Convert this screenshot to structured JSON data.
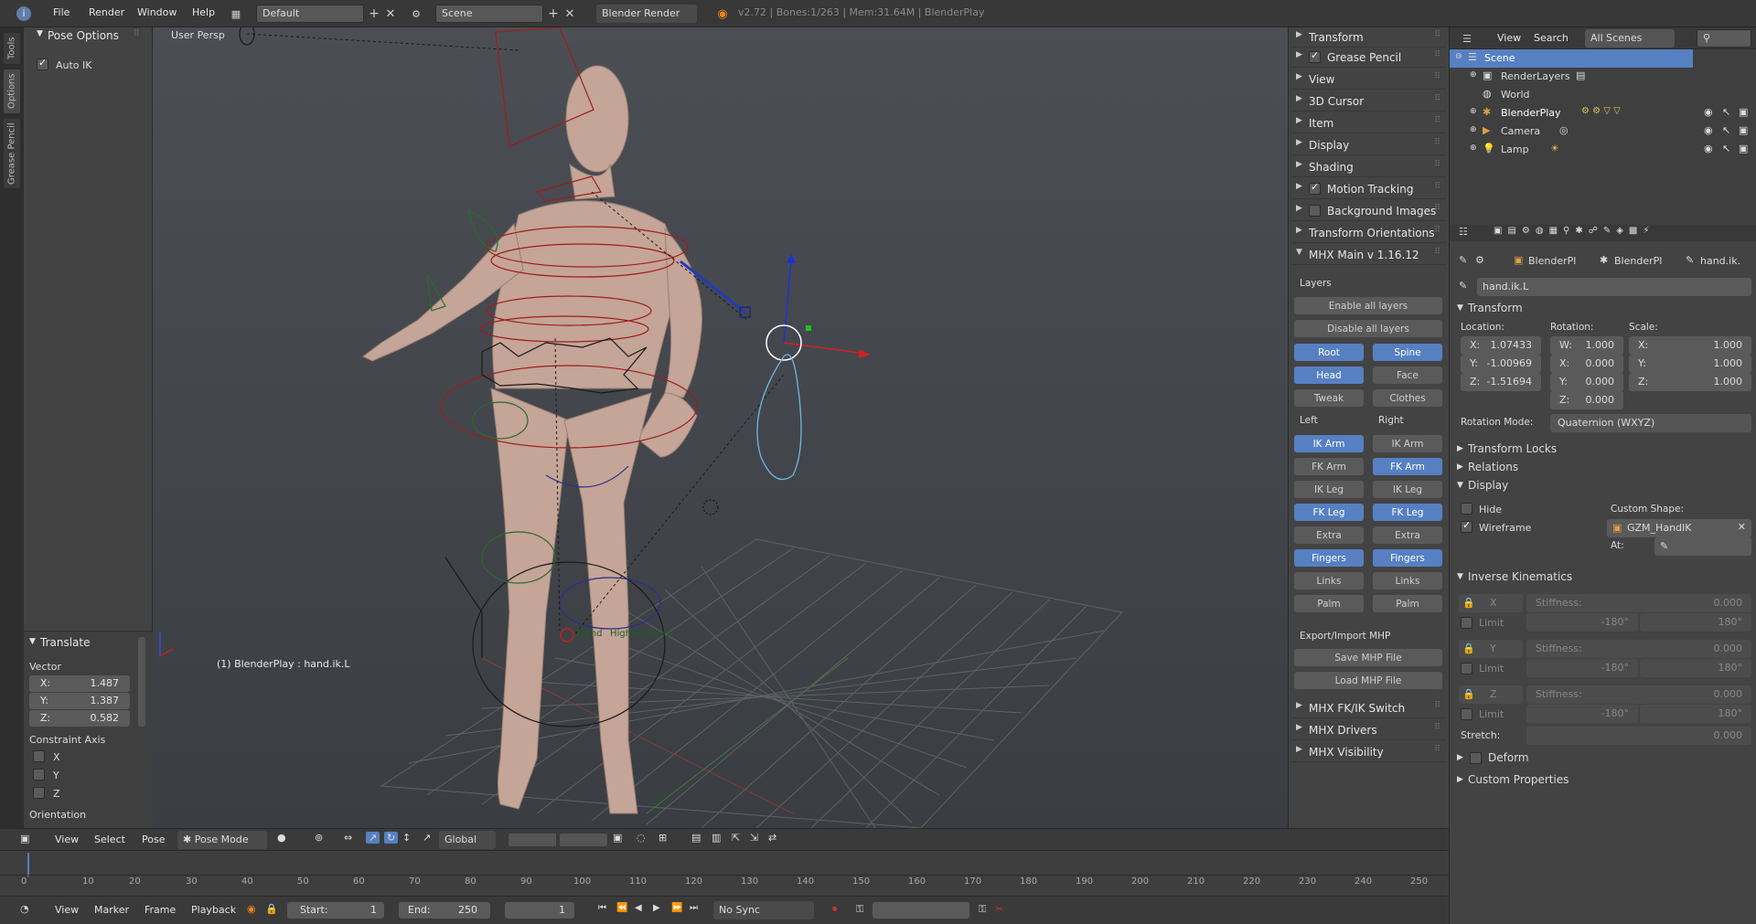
{
  "top": {
    "menus": [
      "File",
      "Render",
      "Window",
      "Help"
    ],
    "layout": "Default",
    "scene": "Scene",
    "engine": "Blender Render",
    "stats": "v2.72 | Bones:1/263 | Mem:31.64M | BlenderPlay"
  },
  "tooltabs": [
    "Tools",
    "Options",
    "Grease Pencil"
  ],
  "tools": {
    "pose_options": "Pose Options",
    "auto_ik": "Auto IK",
    "translate": "Translate",
    "vector": "Vector",
    "x_label": "X:",
    "x": "1.487",
    "y_label": "Y:",
    "y": "1.387",
    "z_label": "Z:",
    "z": "0.582",
    "constraint_axis": "Constraint Axis",
    "ax_x": "X",
    "ax_y": "Y",
    "ax_z": "Z",
    "orientation": "Orientation"
  },
  "viewport": {
    "view_name": "User Persp",
    "object_info": "(1) BlenderPlay : hand.ik.L",
    "label1": "Blend",
    "label2": "HighPolyEyes"
  },
  "npanel": {
    "rows": [
      "Transform",
      "Grease Pencil",
      "View",
      "3D Cursor",
      "Item",
      "Display",
      "Shading",
      "Motion Tracking",
      "Background Images",
      "Transform Orientations"
    ],
    "mhx_main": "MHX Main v 1.16.12",
    "layers": "Layers",
    "enable_all": "Enable all layers",
    "disable_all": "Disable all layers",
    "layer_buttons": [
      [
        "Root",
        "Spine"
      ],
      [
        "Head",
        "Face"
      ],
      [
        "Tweak",
        "Clothes"
      ]
    ],
    "left": "Left",
    "right": "Right",
    "limb_buttons": [
      [
        "IK Arm",
        "IK Arm"
      ],
      [
        "FK Arm",
        "FK Arm"
      ],
      [
        "IK Leg",
        "IK Leg"
      ],
      [
        "FK Leg",
        "FK Leg"
      ],
      [
        "Extra",
        "Extra"
      ],
      [
        "Fingers",
        "Fingers"
      ],
      [
        "Links",
        "Links"
      ],
      [
        "Palm",
        "Palm"
      ]
    ],
    "export_import": "Export/Import MHP",
    "save_mhp": "Save MHP File",
    "load_mhp": "Load MHP File",
    "bottom_rows": [
      "MHX FK/IK Switch",
      "MHX Drivers",
      "MHX Visibility"
    ]
  },
  "outliner": {
    "view": "View",
    "search": "Search",
    "all_scenes": "All Scenes",
    "items": [
      "Scene",
      "RenderLayers",
      "World",
      "BlenderPlay",
      "Camera",
      "Lamp"
    ]
  },
  "props": {
    "crumb1": "BlenderPl",
    "crumb2": "BlenderPl",
    "crumb3": "hand.ik.",
    "bone_name": "hand.ik.L",
    "transform": "Transform",
    "location": "Location:",
    "rotation": "Rotation:",
    "scale": "Scale:",
    "loc": [
      {
        "k": "X:",
        "v": "1.07433"
      },
      {
        "k": "Y:",
        "v": "-1.00969"
      },
      {
        "k": "Z:",
        "v": "-1.51694"
      }
    ],
    "rot": [
      {
        "k": "W:",
        "v": "1.000"
      },
      {
        "k": "X:",
        "v": "0.000"
      },
      {
        "k": "Y:",
        "v": "0.000"
      },
      {
        "k": "Z:",
        "v": "0.000"
      }
    ],
    "scl": [
      {
        "k": "X:",
        "v": "1.000"
      },
      {
        "k": "Y:",
        "v": "1.000"
      },
      {
        "k": "Z:",
        "v": "1.000"
      }
    ],
    "rotation_mode_label": "Rotation Mode:",
    "rotation_mode": "Quaternion (WXYZ)",
    "transform_locks": "Transform Locks",
    "relations": "Relations",
    "display": "Display",
    "hide": "Hide",
    "custom_shape": "Custom Shape:",
    "wireframe": "Wireframe",
    "shape": "GZM_HandIK",
    "at": "At:",
    "ik": "Inverse Kinematics",
    "ik_rows": [
      {
        "axis": "X",
        "stiff": "Stiffness:",
        "sv": "0.000",
        "limit": "Limit",
        "lo": "-180°",
        "hi": "180°"
      },
      {
        "axis": "Y",
        "stiff": "Stiffness:",
        "sv": "0.000",
        "limit": "Limit",
        "lo": "-180°",
        "hi": "180°"
      },
      {
        "axis": "Z",
        "stiff": "Stiffness:",
        "sv": "0.000",
        "limit": "Limit",
        "lo": "-180°",
        "hi": "180°"
      }
    ],
    "stretch": "Stretch:",
    "stretch_v": "0.000",
    "deform": "Deform",
    "custom_props": "Custom Properties"
  },
  "vbar": {
    "view": "View",
    "select": "Select",
    "pose": "Pose",
    "mode": "Pose Mode",
    "orient": "Global"
  },
  "timeline": {
    "ticks": [
      "0",
      "10",
      "20",
      "30",
      "40",
      "50",
      "60",
      "70",
      "80",
      "90",
      "100",
      "110",
      "120",
      "130",
      "140",
      "150",
      "160",
      "170",
      "180",
      "190",
      "200",
      "210",
      "220",
      "230",
      "240",
      "250"
    ],
    "view": "View",
    "marker": "Marker",
    "frame": "Frame",
    "playback": "Playback",
    "start_label": "Start:",
    "start": "1",
    "end_label": "End:",
    "end": "250",
    "current": "1",
    "sync": "No Sync"
  }
}
